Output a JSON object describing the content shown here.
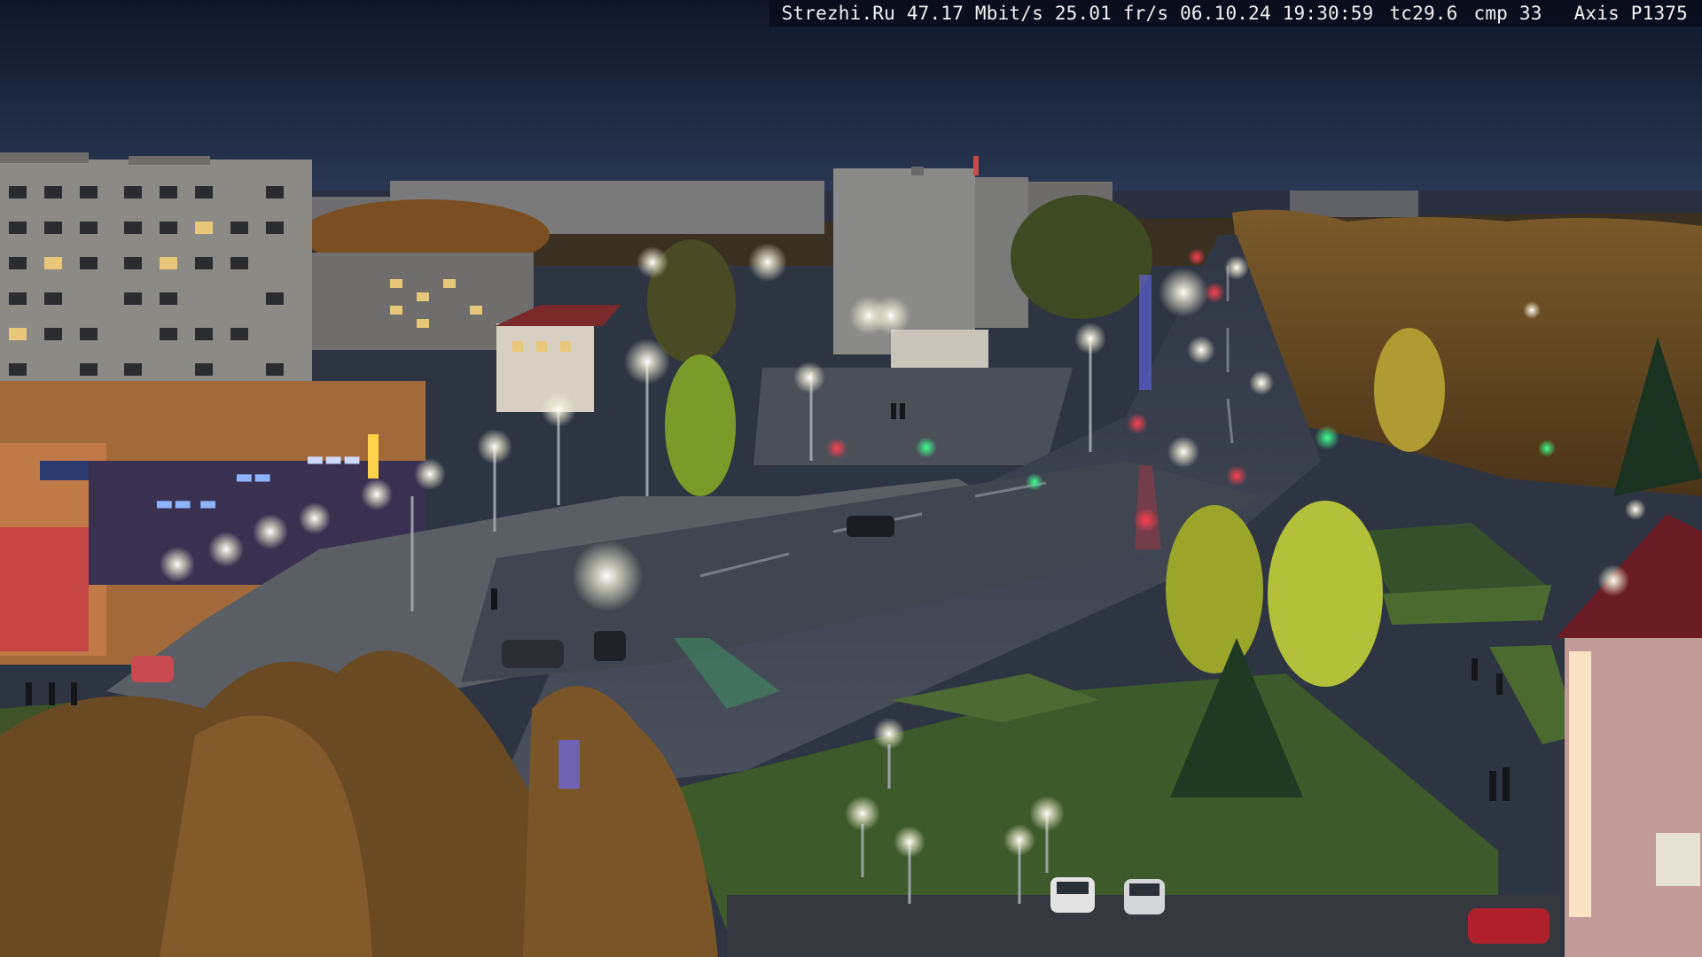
{
  "overlay": {
    "site": "Strezhi.Ru",
    "bitrate": "47.17 Mbit/s",
    "fps": "25.01 fr/s",
    "date": "06.10.24",
    "time": "19:30:59",
    "tc": "tc29.6",
    "cmp": "cmp 33",
    "camera": "Axis P1375"
  },
  "scene": {
    "colors": {
      "sky_top": "#121a2e",
      "sky_horizon": "#2c3a55",
      "asphalt": "#3b4150",
      "grass": "#3d5a2a",
      "autumn_trees": "#8a5a24",
      "lamp_glow": "#f4f1d8",
      "shop_sign": "#8fb4ff"
    }
  }
}
